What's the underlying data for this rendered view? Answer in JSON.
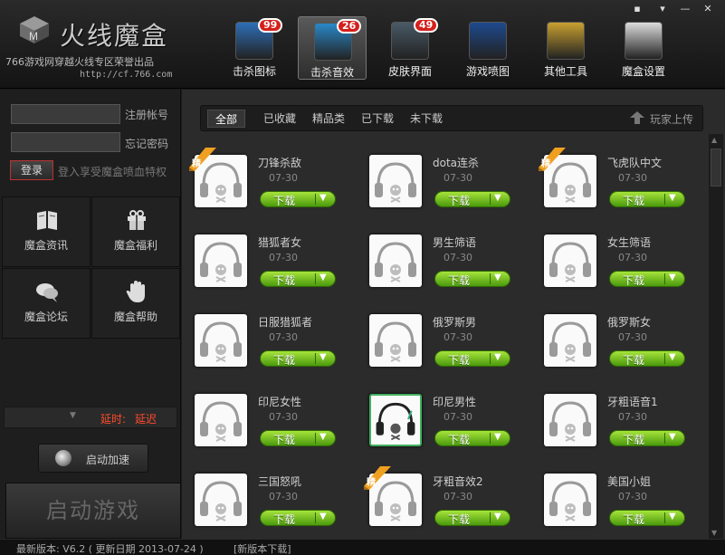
{
  "header": {
    "title": "火线魔盒",
    "subtitle": "766游戏网穿越火线专区荣誉出品",
    "url": "http://cf.766.com"
  },
  "window_controls": {
    "feedback_icon": "chat-icon",
    "minimize_icon": "minimize-icon",
    "close_icon": "close-icon"
  },
  "nav": [
    {
      "label": "击杀图标",
      "badge": "99",
      "icon": "skull-helmet-icon",
      "color": "#2e6fb8"
    },
    {
      "label": "击杀音效",
      "badge": "26",
      "icon": "music-note-icon",
      "color": "#2a88c8",
      "active": true
    },
    {
      "label": "皮肤界面",
      "badge": "49",
      "icon": "soldier-skin-icon",
      "color": "#4a5a66"
    },
    {
      "label": "游戏喷图",
      "badge": "",
      "icon": "spray-icon",
      "color": "#1d4a8c"
    },
    {
      "label": "其他工具",
      "badge": "",
      "icon": "toolbox-icon",
      "color": "#c8a030"
    },
    {
      "label": "魔盒设置",
      "badge": "",
      "icon": "settings-grid-icon",
      "color": "#dcdcdc"
    }
  ],
  "sidebar": {
    "register_label": "注册帐号",
    "forgot_label": "忘记密码",
    "login_label": "登录",
    "login_hint": "登入享受魔盒喷血特权",
    "grid": [
      {
        "label": "魔盒资讯",
        "icon": "book-icon"
      },
      {
        "label": "魔盒福利",
        "icon": "gift-icon"
      },
      {
        "label": "魔盒论坛",
        "icon": "chat-bubbles-icon"
      },
      {
        "label": "魔盒帮助",
        "icon": "hand-icon"
      }
    ],
    "delay_label": "延时:",
    "delay_value": "延迟",
    "accelerate_label": "启动加速",
    "start_game_label": "启动游戏"
  },
  "tabs": [
    {
      "label": "全部",
      "active": true
    },
    {
      "label": "已收藏"
    },
    {
      "label": "精品类"
    },
    {
      "label": "已下载"
    },
    {
      "label": "未下载"
    }
  ],
  "upload_label": "玩家上传",
  "download_label": "下载",
  "ribbon_label": "精",
  "items": [
    {
      "title": "刀锋杀敌",
      "date": "07-30",
      "featured": true
    },
    {
      "title": "dota连杀",
      "date": "07-30",
      "featured": false
    },
    {
      "title": "飞虎队中文",
      "date": "07-30",
      "featured": true
    },
    {
      "title": "猎狐者女",
      "date": "07-30",
      "featured": false
    },
    {
      "title": "男生筛语",
      "date": "07-30",
      "featured": false
    },
    {
      "title": "女生筛语",
      "date": "07-30",
      "featured": false
    },
    {
      "title": "日服猎狐者",
      "date": "07-30",
      "featured": false
    },
    {
      "title": "俄罗斯男",
      "date": "07-30",
      "featured": false
    },
    {
      "title": "俄罗斯女",
      "date": "07-30",
      "featured": false
    },
    {
      "title": "印尼女性",
      "date": "07-30",
      "featured": false
    },
    {
      "title": "印尼男性",
      "date": "07-30",
      "featured": false,
      "selected": true
    },
    {
      "title": "牙粗语音1",
      "date": "07-30",
      "featured": false
    },
    {
      "title": "三国怒吼",
      "date": "07-30",
      "featured": false
    },
    {
      "title": "牙粗音效2",
      "date": "07-30",
      "featured": true
    },
    {
      "title": "美国小姐",
      "date": "07-30",
      "featured": false
    }
  ],
  "footer": {
    "version_text": "最新版本: V6.2 ( 更新日期 2013-07-24 )",
    "new_download": "[新版本下载]"
  }
}
